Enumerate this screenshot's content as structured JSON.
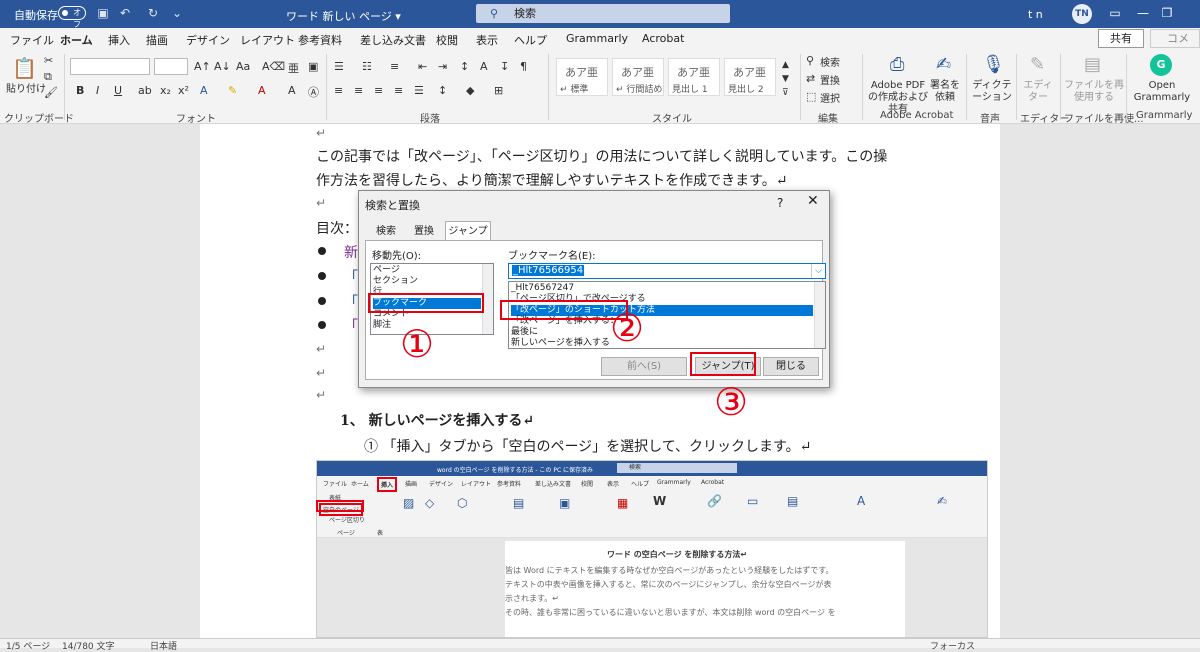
{
  "titlebar": {
    "autosave_label": "自動保存",
    "autosave_state": "オフ",
    "document_title": "ワード 新しい ページ ▾",
    "search_placeholder": "検索",
    "user_initials": "t n",
    "avatar_initials": "TN"
  },
  "ribbon_tabs": [
    "ファイル",
    "ホーム",
    "挿入",
    "描画",
    "デザイン",
    "レイアウト",
    "参考資料",
    "差し込み文書",
    "校閲",
    "表示",
    "ヘルプ",
    "Grammarly",
    "Acrobat"
  ],
  "share_label": "共有",
  "comment_label": "コメント",
  "ribbon": {
    "paste_label": "貼り付け",
    "groups": {
      "clipboard": "クリップボード",
      "font": "フォント",
      "paragraph": "段落",
      "styles": "スタイル",
      "editing": "編集",
      "adobe": "Adobe Acrobat",
      "voice": "音声",
      "editor": "エディター",
      "reuse": "ファイルを再使...",
      "grammarly": "Grammarly"
    },
    "styles": [
      {
        "sample": "あア亜",
        "name": "↵ 標準"
      },
      {
        "sample": "あア亜",
        "name": "↵ 行間詰め"
      },
      {
        "sample": "あア亜",
        "name": "見出し 1"
      },
      {
        "sample": "あア亜",
        "name": "見出し 2"
      }
    ],
    "editing": {
      "find": "検索",
      "replace": "置換",
      "select": "選択"
    },
    "adobe_button": "Adobe PDF の作成および共有",
    "sign_button": "署名を依頼",
    "dictate_button": "ディクテーション",
    "editor_button": "エディター",
    "reuse_button": "ファイルを再使用する",
    "grammarly_button": "Open Grammarly"
  },
  "document": {
    "paragraph_1a": "この記事では「改ページ」、「ページ区切り」の用法について詳しく説明しています。この操",
    "paragraph_1b": "作方法を習得したら、より簡潔で理解しやすいテキストを作成できます。↵",
    "toc_label": "目次：",
    "bullet_1": "新",
    "bullet_2": "「",
    "bullet_3": "「",
    "bullet_4": "「",
    "heading_1": "1、 新しいページを挿入する↵",
    "step_1": "① 「挿入」タブから「空白のページ」を選択して、クリックします。↵",
    "return_mark": "↵"
  },
  "dialog": {
    "title": "検索と置換",
    "help": "?",
    "close": "✕",
    "tabs": [
      "検索",
      "置換",
      "ジャンプ"
    ],
    "goto_label": "移動先(O):",
    "goto_items": [
      "ページ",
      "セクション",
      "行",
      "ブックマーク",
      "コメント",
      "脚注"
    ],
    "bookmark_label": "ブックマーク名(E):",
    "bookmark_value": "_Hlt76566954",
    "bookmark_items": [
      "_Hlt76567247",
      "「ページ区切り」で改ページする",
      "「改ページ」のショートカット方法",
      "「改ページ」を挿入する：",
      "最後に",
      "新しいページを挿入する"
    ],
    "prev_button": "前へ(S)",
    "jump_button": "ジャンプ(T)",
    "close_button": "閉じる"
  },
  "annotations": [
    "①",
    "②",
    "③"
  ],
  "embedded_screenshot": {
    "title": "word の空白ページ を削除する方法 - この PC に保存済み",
    "search": "検索",
    "tabs": [
      "ファイル",
      "ホーム",
      "挿入",
      "描画",
      "デザイン",
      "レイアウト",
      "参考資料",
      "差し込み文書",
      "校閲",
      "表示",
      "ヘルプ",
      "Grammarly",
      "Acrobat"
    ],
    "cover_page": "表紙",
    "blank_page": "空白のページ",
    "page_break": "ページ区切り",
    "group_pages": "ページ",
    "group_table": "表",
    "doc_heading": "ワード の空白ページ を削除する方法↵",
    "doc_line_1": "皆は Word にテキストを編集する時なぜか空白ページがあったという経験をしたはずです。",
    "doc_line_2": "テキストの中表や画像を挿入すると、常に次のページにジャンプし、余分な空白ページが表",
    "doc_line_3": "示されます。↵",
    "doc_line_4": "その時、誰も非常に困っているに違いないと思いますが、本文は削除 word の空白ページ を"
  },
  "status": {
    "page": "1/5 ページ",
    "words": "14/780 文字",
    "language": "日本語",
    "focus": "フォーカス"
  }
}
